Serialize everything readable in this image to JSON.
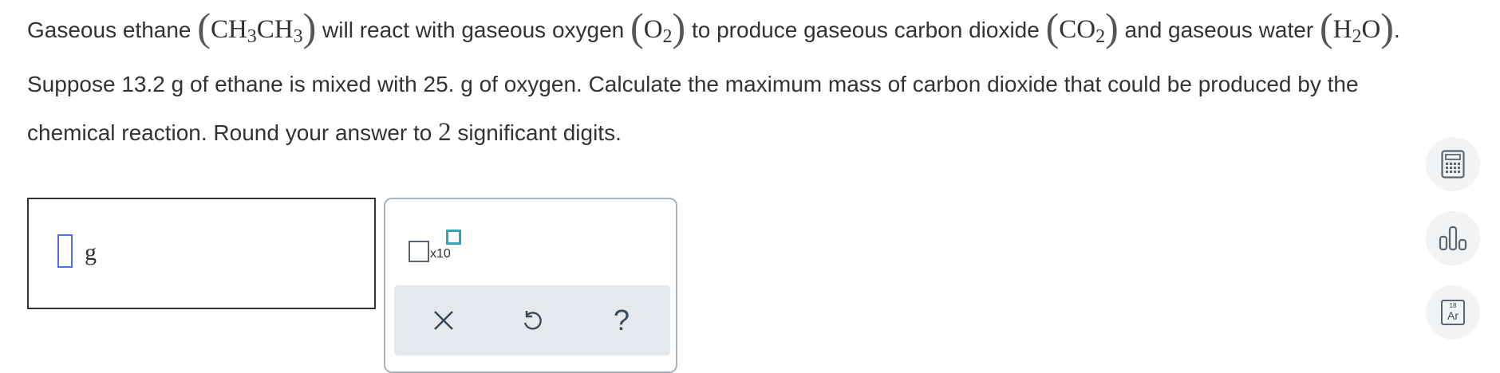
{
  "question": {
    "t1": "Gaseous ethane ",
    "f1": "CH",
    "f1s1": "3",
    "f1b": "CH",
    "f1s2": "3",
    "t2": " will react with gaseous oxygen ",
    "f2": "O",
    "f2s": "2",
    "t3": " to produce gaseous carbon dioxide ",
    "f3": "CO",
    "f3s": "2",
    "t4": " and gaseous water ",
    "f4a": "H",
    "f4s": "2",
    "f4b": "O",
    "t5": ". Suppose 13.2 g of ethane is mixed with 25. g of oxygen. Calculate the maximum mass of carbon dioxide that could be produced by the chemical reaction. Round your answer to ",
    "sig": "2",
    "t6": " significant digits."
  },
  "answer": {
    "unit": "g",
    "value": ""
  },
  "tools": {
    "sci_label": "x10",
    "clear_icon": "close-icon",
    "undo_icon": "undo-icon",
    "help_icon": "help-icon",
    "help_glyph": "?"
  },
  "sidebar": {
    "calculator_icon": "calculator-icon",
    "data_icon": "bar-chart-icon",
    "periodic": {
      "number": "18",
      "symbol": "Ar"
    }
  },
  "colors": {
    "accent_blue": "#4f6cf0",
    "accent_teal": "#2aa7b8",
    "toolbar_bg": "#e3e9ec"
  }
}
